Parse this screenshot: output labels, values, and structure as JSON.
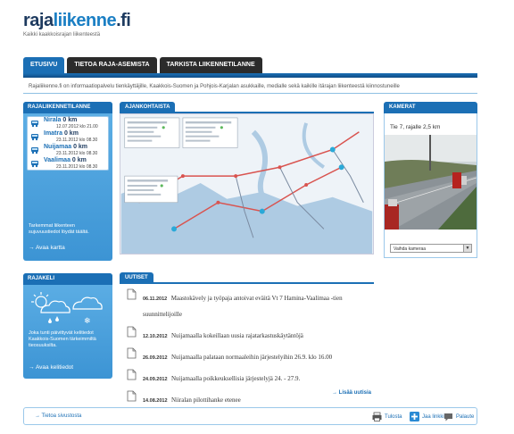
{
  "header": {
    "logo_main": "raja",
    "logo_accent": "liikenne",
    "logo_suffix": ".fi",
    "tagline": "Kaikki kaakkoisrajan liikenteestä"
  },
  "tabs": [
    {
      "label": "ETUSIVU"
    },
    {
      "label": "TIETOA RAJA-ASEMISTA"
    },
    {
      "label": "TARKISTA LIIKENNETILANNE"
    }
  ],
  "intro": "Rajaliikenne.fi on informaatiopalvelu tienkäyttäjille, Kaakkois-Suomen ja Pohjois-Karjalan asukkaille, medialle sekä kaikille itärajan liikenteestä kiinnostuneille",
  "traffic": {
    "heading": "RAJALIIKENNETILANNE",
    "crossings": [
      {
        "name": "Nirala",
        "queue": "0 km",
        "time": "12.07.2012 klo 21.00"
      },
      {
        "name": "Imatra",
        "queue": "0 km",
        "time": "23.11.2012 klo 08.30"
      },
      {
        "name": "Nuijamaa",
        "queue": "0 km",
        "time": "23.11.2012 klo 08.30"
      },
      {
        "name": "Vaalimaa",
        "queue": "0 km",
        "time": "23.11.2012 klo 08.30"
      }
    ],
    "note": "Tarkemmat liikenteen sujuvuustiedot löydät täältä.",
    "map_link": "→ Avaa kartta"
  },
  "weather": {
    "heading": "RAJAKELI",
    "note": "Joka tunti päivittyvät kelitiedot Kaakkois-Suomen tärkeimmiltä tieosuuksilta.",
    "link": "→ Avaa kelitiedot"
  },
  "overview": {
    "heading": "AJANKOHTAISTA"
  },
  "news": {
    "heading": "UUTISET",
    "items": [
      {
        "date": "06.11.2012",
        "title": "Maastokävely ja työpaja antoivat eväitä Vt 7 Hamina-Vaalimaa -tien suunnittelijoille"
      },
      {
        "date": "12.10.2012",
        "title": "Nuijamaalla kokeillaan uusia rajatarkastusk​äytäntöjä"
      },
      {
        "date": "26.09.2012",
        "title": "Nuijamaalla palataan normaaleihin järjestelyihin 26.9. klo 16.00"
      },
      {
        "date": "24.09.2012",
        "title": "Nuijamaalla poikkeuksellisia järjestelyjä 24. - 27.9."
      },
      {
        "date": "14.08.2012",
        "title": "Niiralan pilottihanke etenee"
      }
    ],
    "more": "→ Lisää uutisia"
  },
  "cameras": {
    "heading": "KAMERAT",
    "title": "Tie 7, rajalle 2,5 km",
    "select_label": "Vaihda kameraa"
  },
  "footer": {
    "info_link": "→ Tietoa sivustosta",
    "print": "Tulosta",
    "share": "Jaa linkki",
    "feedback": "Palaute"
  },
  "colors": {
    "accent": "#1b6fb5",
    "panel": "#3c94d4",
    "dark_tab": "#2b2b2b"
  }
}
